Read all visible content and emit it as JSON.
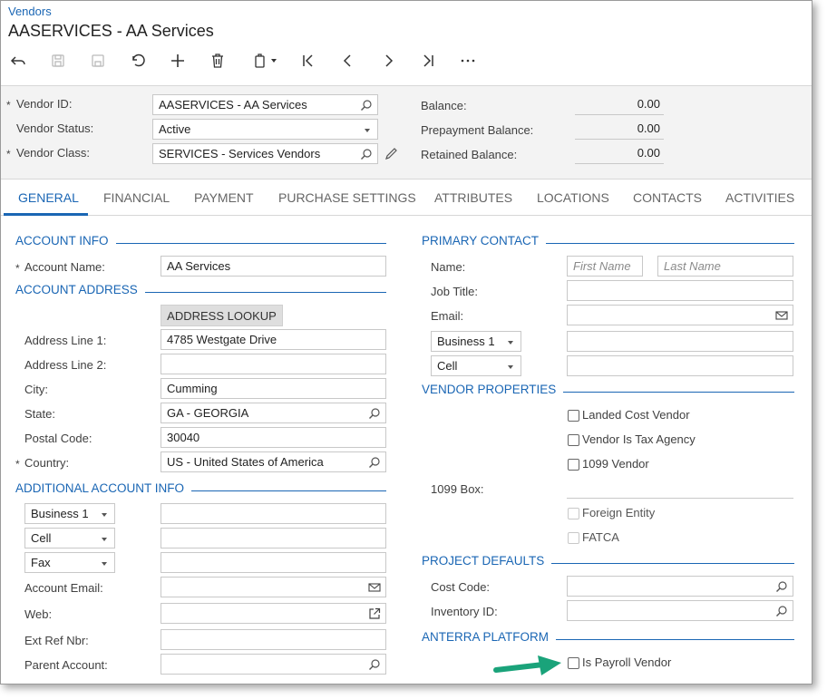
{
  "header": {
    "breadcrumb": "Vendors",
    "title": "AASERVICES - AA Services"
  },
  "toolbar": {
    "buttons": [
      "back-icon",
      "save-icon",
      "save-close-icon",
      "undo-icon",
      "add-icon",
      "delete-icon",
      "copy-paste-icon",
      "first-icon",
      "previous-icon",
      "next-icon",
      "last-icon",
      "more-icon"
    ]
  },
  "summary": {
    "vendor_id_label": "Vendor ID:",
    "vendor_id_value": "AASERVICES - AA Services",
    "vendor_status_label": "Vendor Status:",
    "vendor_status_value": "Active",
    "vendor_class_label": "Vendor Class:",
    "vendor_class_value": "SERVICES - Services Vendors",
    "balance_label": "Balance:",
    "balance_value": "0.00",
    "prepayment_label": "Prepayment Balance:",
    "prepayment_value": "0.00",
    "retained_label": "Retained Balance:",
    "retained_value": "0.00",
    "required_mark": "*"
  },
  "tabs": [
    "GENERAL",
    "FINANCIAL",
    "PAYMENT",
    "PURCHASE SETTINGS",
    "ATTRIBUTES",
    "LOCATIONS",
    "CONTACTS",
    "ACTIVITIES"
  ],
  "account_info": {
    "title": "ACCOUNT INFO",
    "account_name_label": "Account Name:",
    "account_name_value": "AA Services"
  },
  "account_address": {
    "title": "ACCOUNT ADDRESS",
    "lookup_button": "ADDRESS LOOKUP",
    "address1_label": "Address Line 1:",
    "address1_value": "4785 Westgate Drive",
    "address2_label": "Address Line 2:",
    "address2_value": "",
    "city_label": "City:",
    "city_value": "Cumming",
    "state_label": "State:",
    "state_value": "GA - GEORGIA",
    "postal_label": "Postal Code:",
    "postal_value": "30040",
    "country_label": "Country:",
    "country_value": "US - United States of America"
  },
  "additional_info": {
    "title": "ADDITIONAL ACCOUNT INFO",
    "phone1_type": "Business 1",
    "phone2_type": "Cell",
    "phone3_type": "Fax",
    "account_email_label": "Account Email:",
    "web_label": "Web:",
    "ext_ref_label": "Ext Ref Nbr:",
    "parent_label": "Parent Account:"
  },
  "primary_contact": {
    "title": "PRIMARY CONTACT",
    "name_label": "Name:",
    "first_name_placeholder": "First Name",
    "last_name_placeholder": "Last Name",
    "job_title_label": "Job Title:",
    "email_label": "Email:",
    "phone1_type": "Business 1",
    "phone2_type": "Cell"
  },
  "vendor_properties": {
    "title": "VENDOR PROPERTIES",
    "landed_cost": "Landed Cost Vendor",
    "tax_agency": "Vendor Is Tax Agency",
    "vendor_1099": "1099 Vendor",
    "box_1099_label": "1099 Box:",
    "foreign_entity": "Foreign Entity",
    "fatca": "FATCA"
  },
  "project_defaults": {
    "title": "PROJECT DEFAULTS",
    "cost_code_label": "Cost Code:",
    "inventory_id_label": "Inventory ID:"
  },
  "anterra": {
    "title": "ANTERRA PLATFORM",
    "payroll_vendor": "Is Payroll Vendor"
  },
  "colors": {
    "accent": "#1a66b4",
    "arrow": "#1aa37a"
  }
}
